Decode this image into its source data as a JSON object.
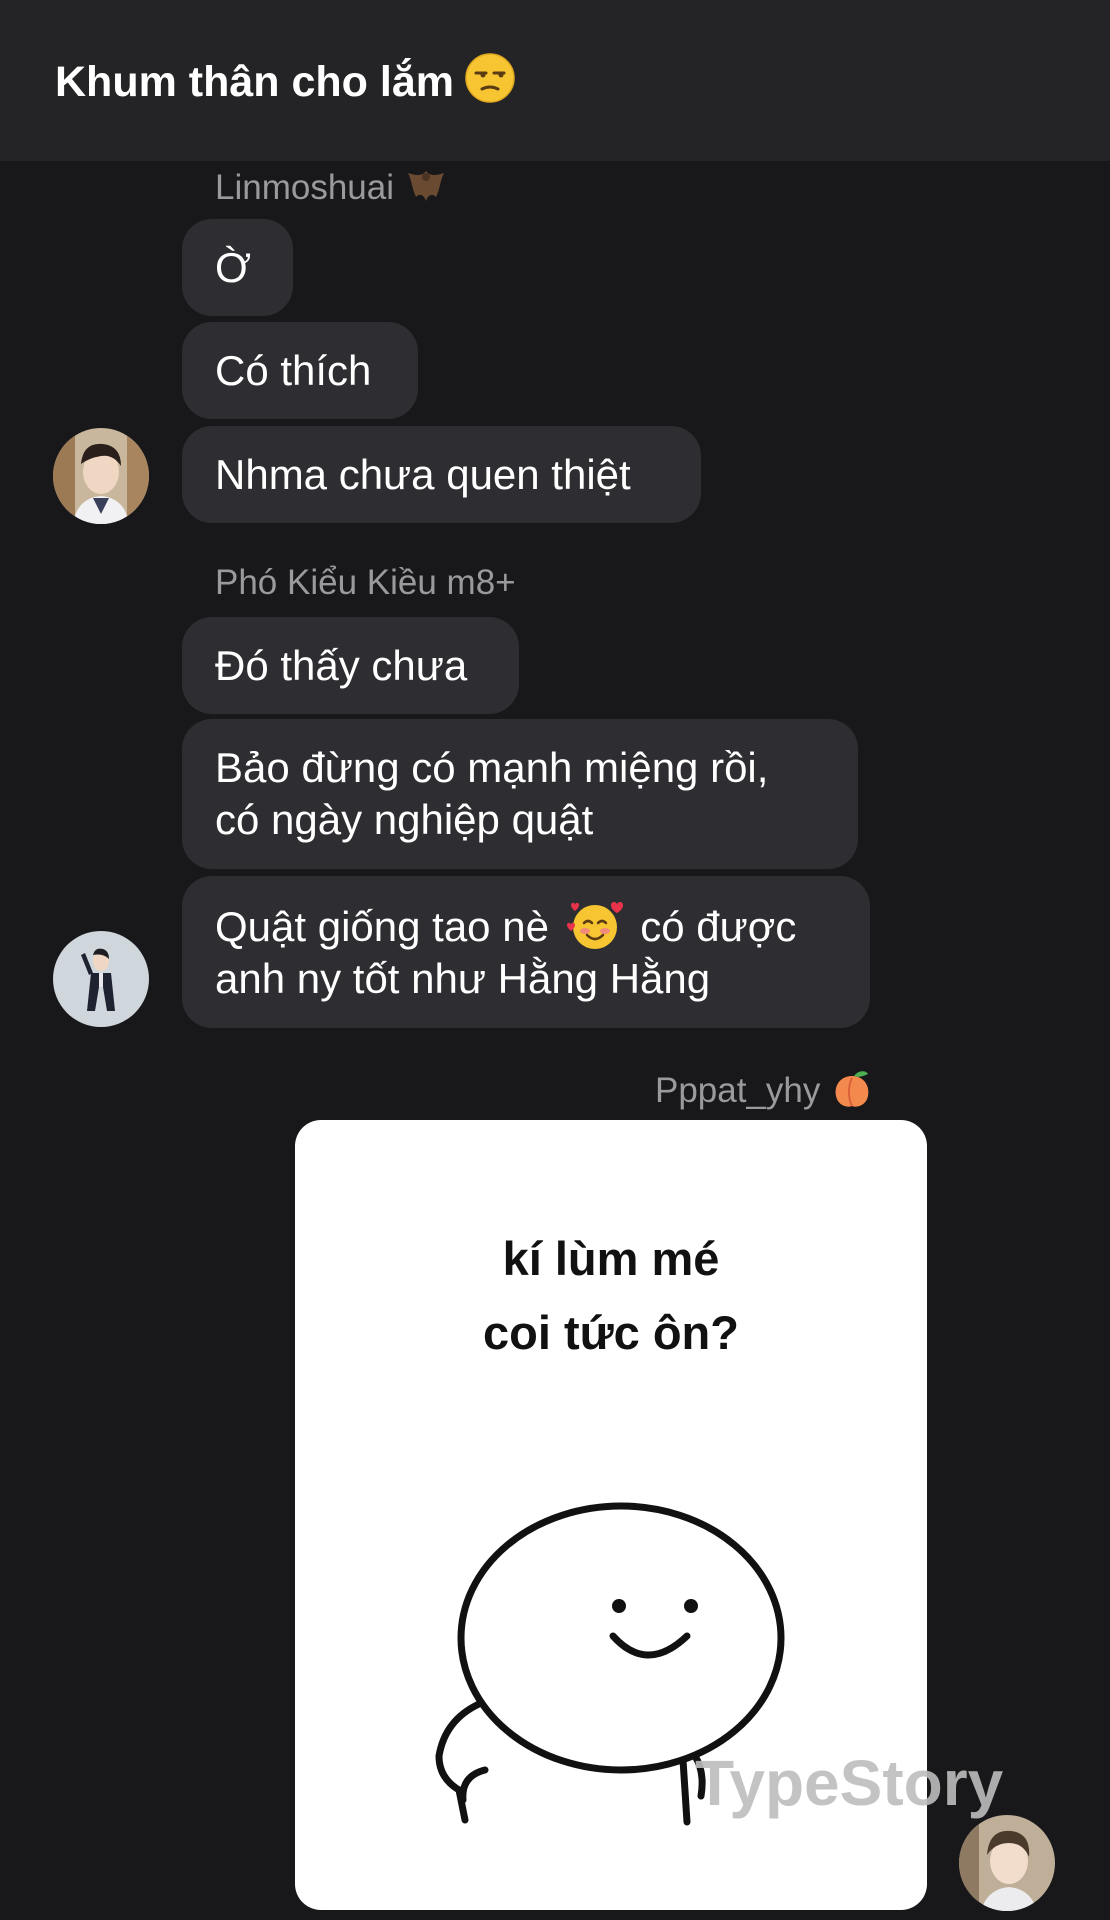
{
  "header": {
    "title": "Khum thân cho lắm",
    "title_emoji": "unamused-face-icon"
  },
  "messages": [
    {
      "sender": "Linmoshuai",
      "sender_emoji": "bat-icon",
      "bubbles": [
        "Ờ",
        "Có thích",
        "Nhma chưa quen thiệt"
      ]
    },
    {
      "sender": "Phó Kiểu Kiều m8+",
      "bubbles": [
        "Đó thấy chưa",
        [
          "Bảo đừng có mạnh miệng rồi,",
          "có ngày nghiệp quật"
        ],
        [
          "Quật giống tao nè",
          "có được",
          "anh ny tốt như Hằng Hằng"
        ]
      ],
      "inline_emoji": "smiling-face-with-hearts-icon"
    },
    {
      "sender": "Pppat_yhy",
      "sender_emoji": "peach-icon",
      "sticker": {
        "caption_line1": "kí lùm mé",
        "caption_line2": "coi tức ôn?"
      }
    }
  ],
  "watermark": "TypeStory",
  "colors": {
    "background": "#18181a",
    "header": "#242426",
    "bubble": "#2e2e32",
    "sender_text": "#9a9a9e",
    "text": "#ffffff"
  }
}
